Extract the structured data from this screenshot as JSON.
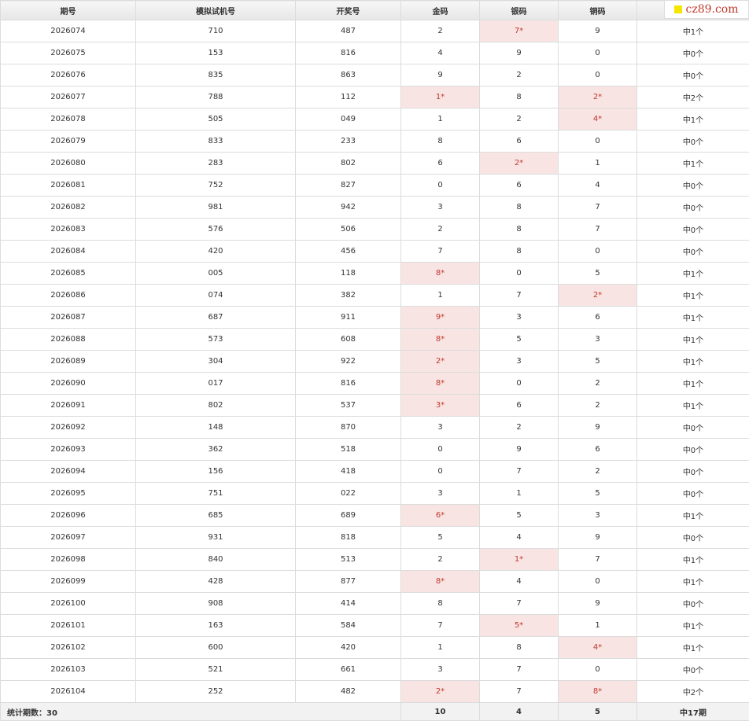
{
  "headers": [
    "期号",
    "模拟试机号",
    "开奖号",
    "金码",
    "银码",
    "铜码",
    ""
  ],
  "watermark": "cz89.com",
  "rows": [
    {
      "period": "2026074",
      "sim": "710",
      "draw": "487",
      "gold": "2",
      "silver": "7*",
      "bronze": "9",
      "result": "中1个",
      "hits": [
        false,
        true,
        false
      ]
    },
    {
      "period": "2026075",
      "sim": "153",
      "draw": "816",
      "gold": "4",
      "silver": "9",
      "bronze": "0",
      "result": "中0个",
      "hits": [
        false,
        false,
        false
      ]
    },
    {
      "period": "2026076",
      "sim": "835",
      "draw": "863",
      "gold": "9",
      "silver": "2",
      "bronze": "0",
      "result": "中0个",
      "hits": [
        false,
        false,
        false
      ]
    },
    {
      "period": "2026077",
      "sim": "788",
      "draw": "112",
      "gold": "1*",
      "silver": "8",
      "bronze": "2*",
      "result": "中2个",
      "hits": [
        true,
        false,
        true
      ]
    },
    {
      "period": "2026078",
      "sim": "505",
      "draw": "049",
      "gold": "1",
      "silver": "2",
      "bronze": "4*",
      "result": "中1个",
      "hits": [
        false,
        false,
        true
      ]
    },
    {
      "period": "2026079",
      "sim": "833",
      "draw": "233",
      "gold": "8",
      "silver": "6",
      "bronze": "0",
      "result": "中0个",
      "hits": [
        false,
        false,
        false
      ]
    },
    {
      "period": "2026080",
      "sim": "283",
      "draw": "802",
      "gold": "6",
      "silver": "2*",
      "bronze": "1",
      "result": "中1个",
      "hits": [
        false,
        true,
        false
      ]
    },
    {
      "period": "2026081",
      "sim": "752",
      "draw": "827",
      "gold": "0",
      "silver": "6",
      "bronze": "4",
      "result": "中0个",
      "hits": [
        false,
        false,
        false
      ]
    },
    {
      "period": "2026082",
      "sim": "981",
      "draw": "942",
      "gold": "3",
      "silver": "8",
      "bronze": "7",
      "result": "中0个",
      "hits": [
        false,
        false,
        false
      ]
    },
    {
      "period": "2026083",
      "sim": "576",
      "draw": "506",
      "gold": "2",
      "silver": "8",
      "bronze": "7",
      "result": "中0个",
      "hits": [
        false,
        false,
        false
      ]
    },
    {
      "period": "2026084",
      "sim": "420",
      "draw": "456",
      "gold": "7",
      "silver": "8",
      "bronze": "0",
      "result": "中0个",
      "hits": [
        false,
        false,
        false
      ]
    },
    {
      "period": "2026085",
      "sim": "005",
      "draw": "118",
      "gold": "8*",
      "silver": "0",
      "bronze": "5",
      "result": "中1个",
      "hits": [
        true,
        false,
        false
      ]
    },
    {
      "period": "2026086",
      "sim": "074",
      "draw": "382",
      "gold": "1",
      "silver": "7",
      "bronze": "2*",
      "result": "中1个",
      "hits": [
        false,
        false,
        true
      ]
    },
    {
      "period": "2026087",
      "sim": "687",
      "draw": "911",
      "gold": "9*",
      "silver": "3",
      "bronze": "6",
      "result": "中1个",
      "hits": [
        true,
        false,
        false
      ]
    },
    {
      "period": "2026088",
      "sim": "573",
      "draw": "608",
      "gold": "8*",
      "silver": "5",
      "bronze": "3",
      "result": "中1个",
      "hits": [
        true,
        false,
        false
      ]
    },
    {
      "period": "2026089",
      "sim": "304",
      "draw": "922",
      "gold": "2*",
      "silver": "3",
      "bronze": "5",
      "result": "中1个",
      "hits": [
        true,
        false,
        false
      ]
    },
    {
      "period": "2026090",
      "sim": "017",
      "draw": "816",
      "gold": "8*",
      "silver": "0",
      "bronze": "2",
      "result": "中1个",
      "hits": [
        true,
        false,
        false
      ]
    },
    {
      "period": "2026091",
      "sim": "802",
      "draw": "537",
      "gold": "3*",
      "silver": "6",
      "bronze": "2",
      "result": "中1个",
      "hits": [
        true,
        false,
        false
      ]
    },
    {
      "period": "2026092",
      "sim": "148",
      "draw": "870",
      "gold": "3",
      "silver": "2",
      "bronze": "9",
      "result": "中0个",
      "hits": [
        false,
        false,
        false
      ]
    },
    {
      "period": "2026093",
      "sim": "362",
      "draw": "518",
      "gold": "0",
      "silver": "9",
      "bronze": "6",
      "result": "中0个",
      "hits": [
        false,
        false,
        false
      ]
    },
    {
      "period": "2026094",
      "sim": "156",
      "draw": "418",
      "gold": "0",
      "silver": "7",
      "bronze": "2",
      "result": "中0个",
      "hits": [
        false,
        false,
        false
      ]
    },
    {
      "period": "2026095",
      "sim": "751",
      "draw": "022",
      "gold": "3",
      "silver": "1",
      "bronze": "5",
      "result": "中0个",
      "hits": [
        false,
        false,
        false
      ]
    },
    {
      "period": "2026096",
      "sim": "685",
      "draw": "689",
      "gold": "6*",
      "silver": "5",
      "bronze": "3",
      "result": "中1个",
      "hits": [
        true,
        false,
        false
      ]
    },
    {
      "period": "2026097",
      "sim": "931",
      "draw": "818",
      "gold": "5",
      "silver": "4",
      "bronze": "9",
      "result": "中0个",
      "hits": [
        false,
        false,
        false
      ]
    },
    {
      "period": "2026098",
      "sim": "840",
      "draw": "513",
      "gold": "2",
      "silver": "1*",
      "bronze": "7",
      "result": "中1个",
      "hits": [
        false,
        true,
        false
      ]
    },
    {
      "period": "2026099",
      "sim": "428",
      "draw": "877",
      "gold": "8*",
      "silver": "4",
      "bronze": "0",
      "result": "中1个",
      "hits": [
        true,
        false,
        false
      ]
    },
    {
      "period": "2026100",
      "sim": "908",
      "draw": "414",
      "gold": "8",
      "silver": "7",
      "bronze": "9",
      "result": "中0个",
      "hits": [
        false,
        false,
        false
      ]
    },
    {
      "period": "2026101",
      "sim": "163",
      "draw": "584",
      "gold": "7",
      "silver": "5*",
      "bronze": "1",
      "result": "中1个",
      "hits": [
        false,
        true,
        false
      ]
    },
    {
      "period": "2026102",
      "sim": "600",
      "draw": "420",
      "gold": "1",
      "silver": "8",
      "bronze": "4*",
      "result": "中1个",
      "hits": [
        false,
        false,
        true
      ]
    },
    {
      "period": "2026103",
      "sim": "521",
      "draw": "661",
      "gold": "3",
      "silver": "7",
      "bronze": "0",
      "result": "中0个",
      "hits": [
        false,
        false,
        false
      ]
    },
    {
      "period": "2026104",
      "sim": "252",
      "draw": "482",
      "gold": "2*",
      "silver": "7",
      "bronze": "8*",
      "result": "中2个",
      "hits": [
        true,
        false,
        true
      ]
    }
  ],
  "footer": {
    "label": "统计期数：30",
    "gold": "10",
    "silver": "4",
    "bronze": "5",
    "total": "中17期"
  },
  "colors": {
    "hit_bg": "#f9e4e4",
    "hit_text": "#c0392b",
    "header_bg": "#eeeeee"
  }
}
